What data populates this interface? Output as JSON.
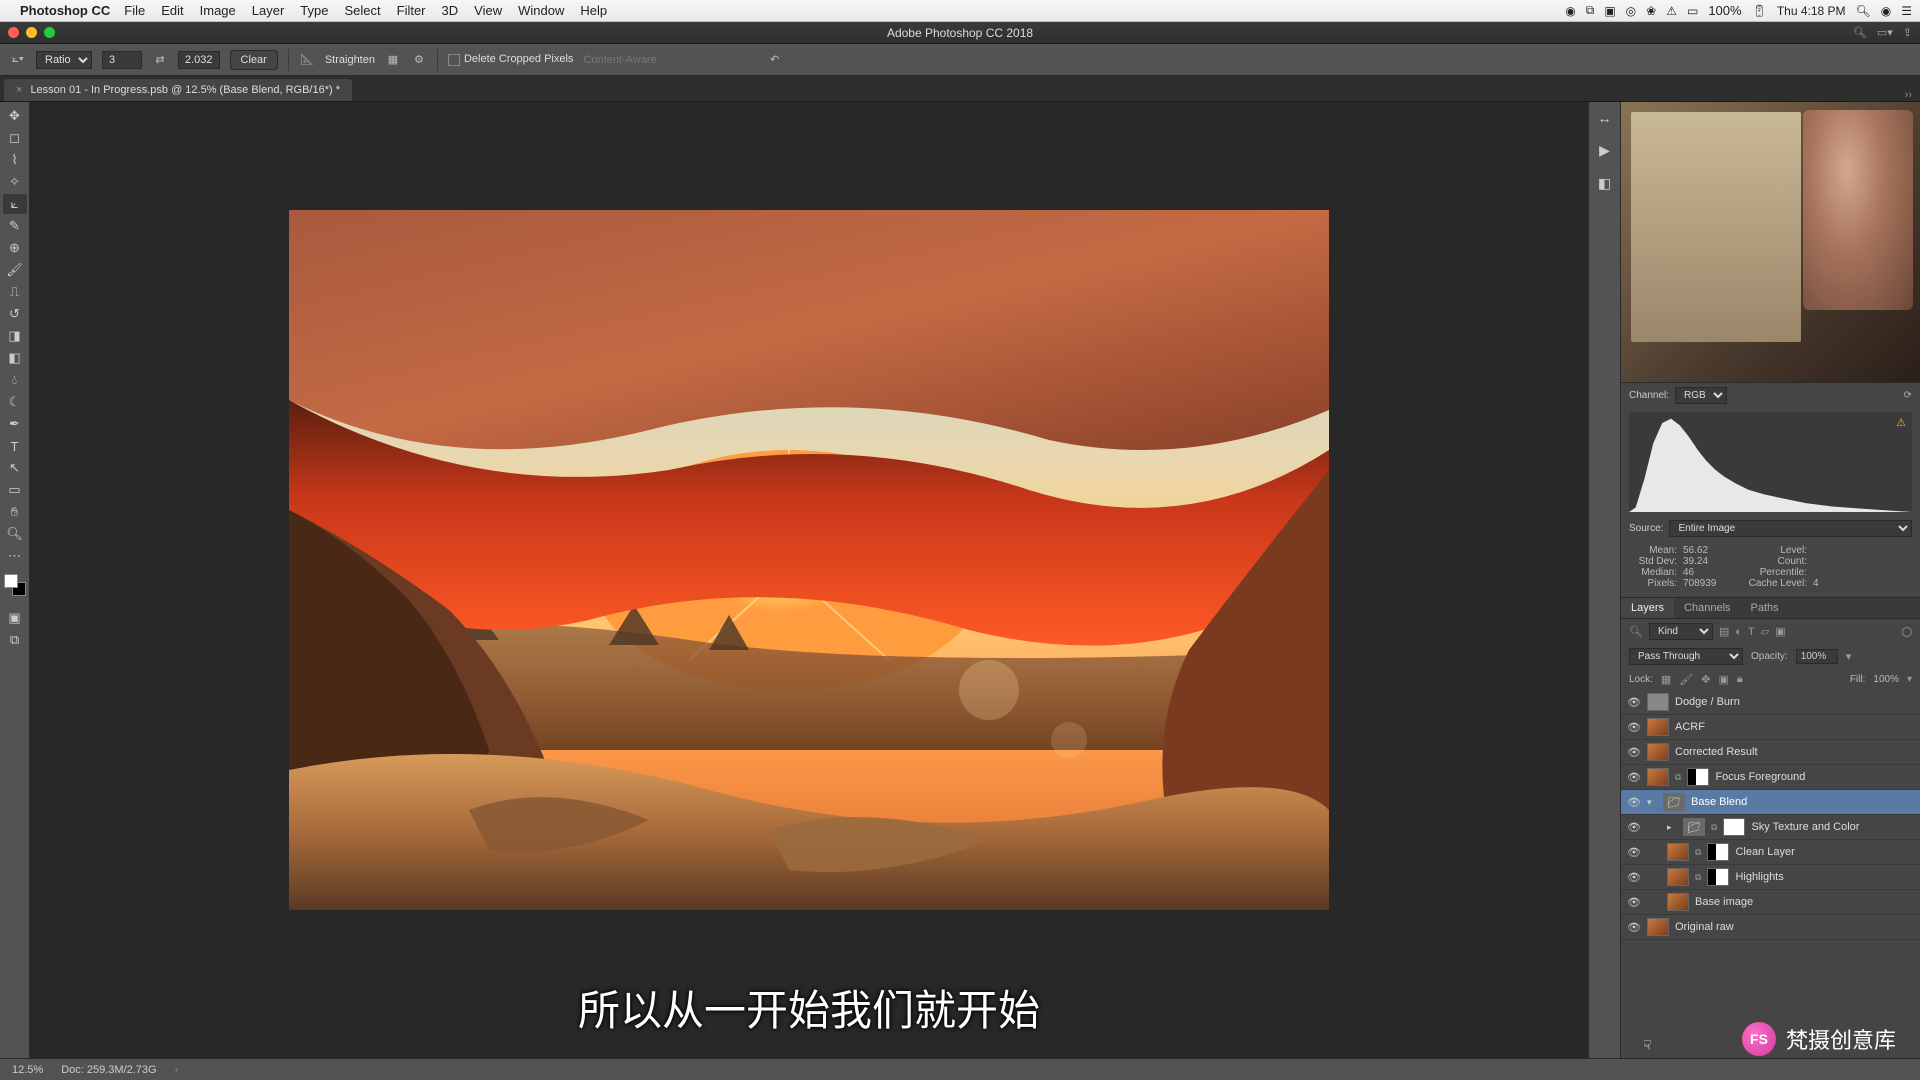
{
  "mac_menu": {
    "app": "Photoshop CC",
    "items": [
      "File",
      "Edit",
      "Image",
      "Layer",
      "Type",
      "Select",
      "Filter",
      "3D",
      "View",
      "Window",
      "Help"
    ],
    "battery": "100%",
    "clock": "Thu 4:18 PM"
  },
  "window_title": "Adobe Photoshop CC 2018",
  "document_tab": {
    "title": "Lesson 01 - In Progress.psb @ 12.5% (Base Blend, RGB/16*) *"
  },
  "options_bar": {
    "ratio_label": "Ratio",
    "val1": "3",
    "val2": "2.032",
    "clear": "Clear",
    "straighten": "Straighten",
    "delete_cropped": "Delete Cropped Pixels",
    "content_aware": "Content-Aware"
  },
  "histogram": {
    "channel_label": "Channel:",
    "channel_value": "RGB",
    "source_label": "Source:",
    "source_value": "Entire Image",
    "stats": {
      "mean_lbl": "Mean:",
      "mean": "56.62",
      "stddev_lbl": "Std Dev:",
      "stddev": "39.24",
      "median_lbl": "Median:",
      "median": "46",
      "pixels_lbl": "Pixels:",
      "pixels": "708939",
      "level_lbl": "Level:",
      "count_lbl": "Count:",
      "percentile_lbl": "Percentile:",
      "cache_lbl": "Cache Level:",
      "cache": "4"
    }
  },
  "layers_panel": {
    "tabs": [
      "Layers",
      "Channels",
      "Paths"
    ],
    "filter_kind": "Kind",
    "blend_mode": "Pass Through",
    "opacity_label": "Opacity:",
    "opacity_value": "100%",
    "lock_label": "Lock:",
    "fill_label": "Fill:",
    "fill_value": "100%",
    "layers": [
      {
        "name": "Dodge / Burn",
        "type": "gray"
      },
      {
        "name": "ACRF",
        "type": "img"
      },
      {
        "name": "Corrected Result",
        "type": "img"
      },
      {
        "name": "Focus Foreground",
        "type": "img",
        "mask": true,
        "link": true
      },
      {
        "name": "Base Blend",
        "type": "folder",
        "expanded": true,
        "selected": true
      },
      {
        "name": "Sky Texture and Color",
        "type": "folder",
        "mask2": true,
        "link": true,
        "indent": 1,
        "collapsed": true
      },
      {
        "name": "Clean Layer",
        "type": "img",
        "mask": true,
        "link": true,
        "indent": 1
      },
      {
        "name": "Highlights",
        "type": "img",
        "mask": true,
        "link": true,
        "indent": 1
      },
      {
        "name": "Base image",
        "type": "img",
        "indent": 1
      },
      {
        "name": "Original raw",
        "type": "img"
      }
    ]
  },
  "status_bar": {
    "zoom": "12.5%",
    "doc": "Doc: 259.3M/2.73G"
  },
  "subtitle": "所以从一开始我们就开始",
  "watermark": "梵摄创意库"
}
